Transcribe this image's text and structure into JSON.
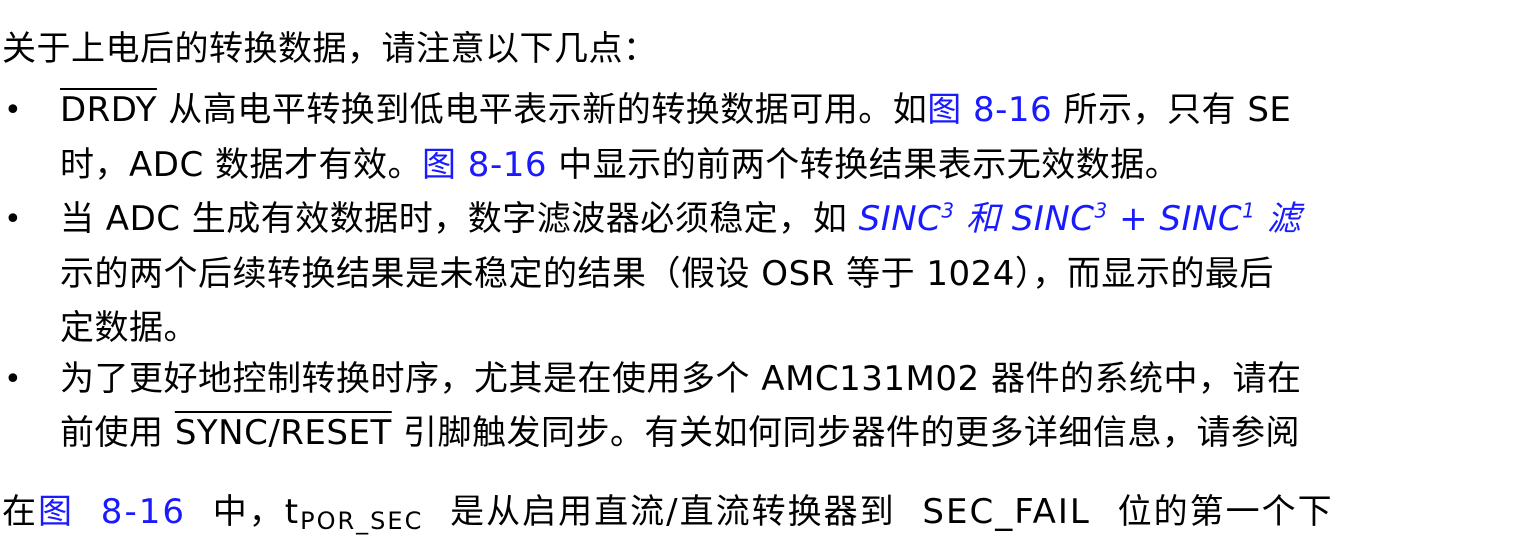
{
  "intro": "关于上电后的转换数据，请注意以下几点：",
  "bullets": [
    {
      "marker": "•",
      "line1": {
        "signal": "DRDY",
        "text_a": " 从高电平转换到低电平表示新的转换数据可用。如",
        "link": "图 8-16",
        "text_b": " 所示，只有 SE"
      },
      "line2": {
        "text_a": "时，ADC 数据才有效。",
        "link": "图 8-16",
        "text_b": " 中显示的前两个转换结果表示无效数据。"
      }
    },
    {
      "marker": "•",
      "line1": {
        "text_a": "当 ADC 生成有效数据时，数字滤波器必须稳定，如 ",
        "link_a": "SINC",
        "sup_a": "3",
        "link_b": " 和 SINC",
        "sup_b": "3",
        "link_c": " + SINC",
        "sup_c": "1",
        "link_d": " 滤"
      },
      "line2": "示的两个后续转换结果是未稳定的结果（假设 OSR 等于 1024），而显示的最后",
      "line3": "定数据。"
    },
    {
      "marker": "•",
      "line1": "为了更好地控制转换时序，尤其是在使用多个 AMC131M02 器件的系统中，请在",
      "line2": {
        "text_a": "前使用 ",
        "signal": "SYNC/RESET",
        "text_b": " 引脚触发同步。有关如何同步器件的更多详细信息，请参阅"
      }
    }
  ],
  "footer": {
    "text_a": "在",
    "link": "图 8-16",
    "text_b": " 中，t",
    "sub": "POR_SEC",
    "text_c": " 是从启用直流/直流转换器到 SEC_FAIL 位的第一个下"
  }
}
